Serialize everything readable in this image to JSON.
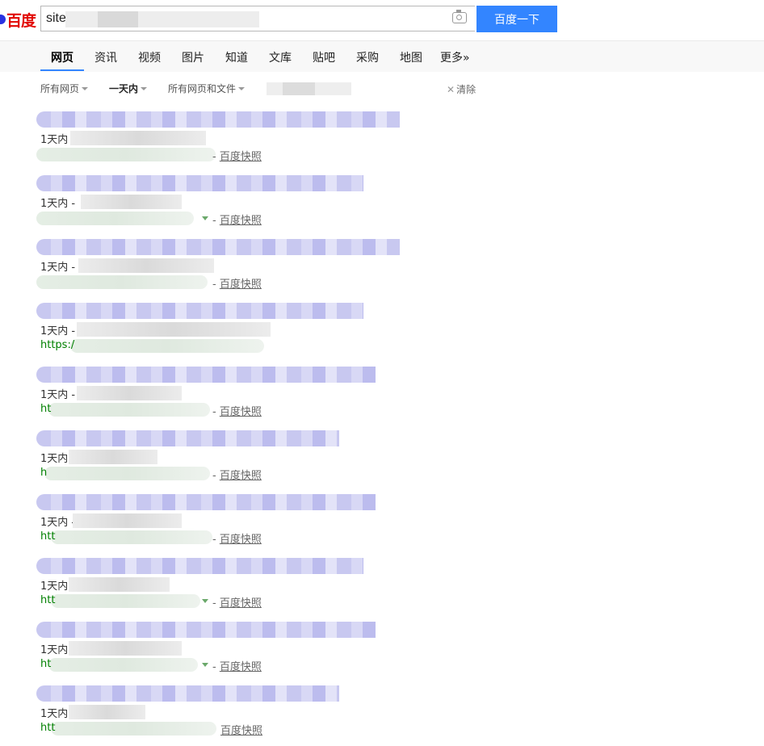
{
  "logo": {
    "text": "百度"
  },
  "search": {
    "query": "site",
    "button_label": "百度一下"
  },
  "tabs": [
    {
      "label": "网页",
      "active": true
    },
    {
      "label": "资讯"
    },
    {
      "label": "视频"
    },
    {
      "label": "图片"
    },
    {
      "label": "知道"
    },
    {
      "label": "文库"
    },
    {
      "label": "贴吧"
    },
    {
      "label": "采购"
    },
    {
      "label": "地图"
    },
    {
      "label": "更多»"
    }
  ],
  "filters": {
    "pages": "所有网页",
    "time": "一天内",
    "filetype": "所有网页和文件",
    "clear": "清除"
  },
  "results": [
    {
      "date": "1天内",
      "url_prefix": "",
      "snapshot": "百度快照"
    },
    {
      "date": "1天内 -",
      "url_prefix": "",
      "snapshot": "百度快照"
    },
    {
      "date": "1天内 -",
      "url_prefix": "",
      "snapshot": "百度快照"
    },
    {
      "date": "1天内 -",
      "url_prefix": "https:/",
      "snapshot": ""
    },
    {
      "date": "1天内 -",
      "url_prefix": "ht",
      "snapshot": "百度快照"
    },
    {
      "date": "1天内",
      "url_prefix": "h",
      "snapshot": "百度快照"
    },
    {
      "date": "1天内 -",
      "url_prefix": "htt",
      "snapshot": "百度快照"
    },
    {
      "date": "1天内",
      "url_prefix": "htt",
      "snapshot": "百度快照"
    },
    {
      "date": "1天内",
      "url_prefix": "ht",
      "snapshot": "百度快照"
    },
    {
      "date": "1天内",
      "url_prefix": "htt",
      "snapshot": "百度快照"
    }
  ]
}
